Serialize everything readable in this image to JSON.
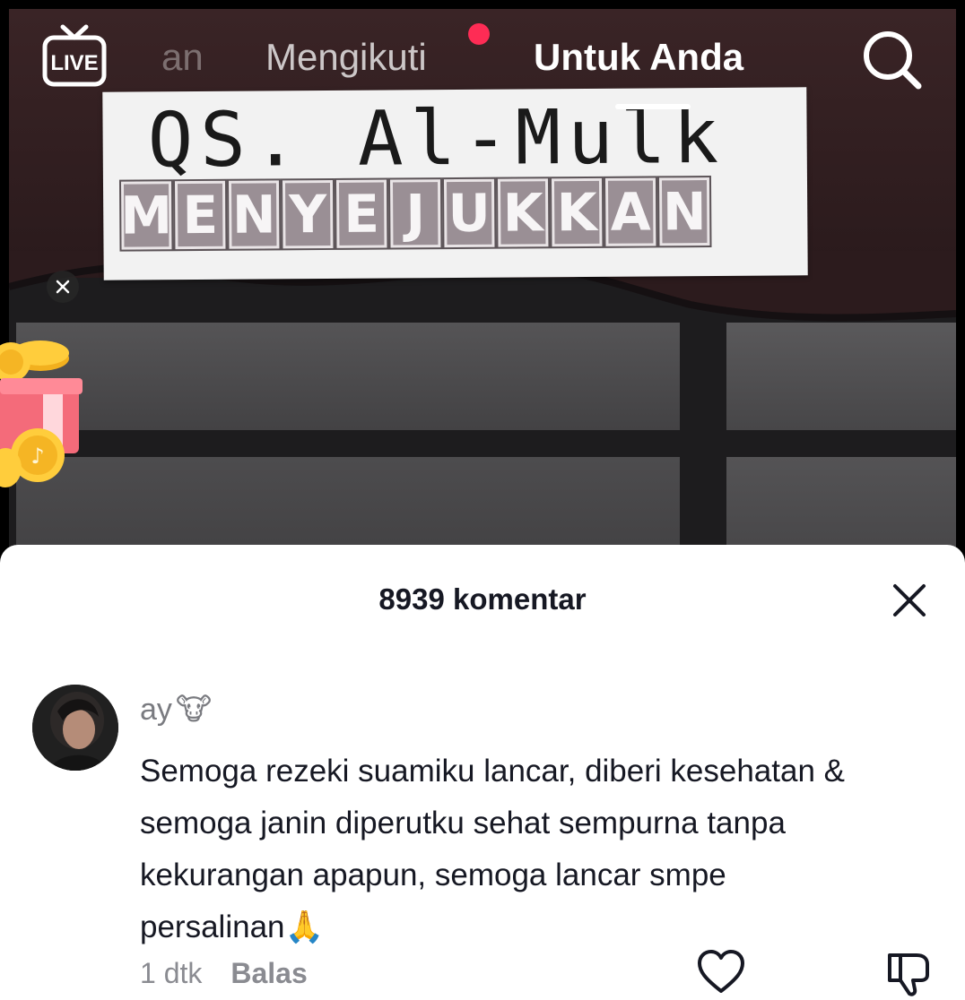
{
  "top_nav": {
    "live_label": "LIVE",
    "partial_tab": "an",
    "following_tab": "Mengikuti",
    "for_you_tab": "Untuk Anda",
    "search_icon": "search-icon"
  },
  "video": {
    "title_line": "QS. Al-Mulk",
    "subtitle_letters": [
      "M",
      "E",
      "N",
      "Y",
      "E",
      "J",
      "U",
      "K",
      "K",
      "A",
      "N"
    ]
  },
  "comments_panel": {
    "title": "8939 komentar",
    "close_icon": "close-icon",
    "comment": {
      "username": "ay",
      "username_emoji": "🐮",
      "text": "Semoga rezeki suamiku lancar, diberi kesehatan & semoga janin diperutku sehat sempurna tanpa kekurangan apapun, semoga lancar smpe persalinan🙏",
      "time": "1 dtk",
      "reply_label": "Balas"
    }
  },
  "colors": {
    "accent": "#fe2c55",
    "text_primary": "#161823",
    "text_secondary": "#8a8b91"
  }
}
